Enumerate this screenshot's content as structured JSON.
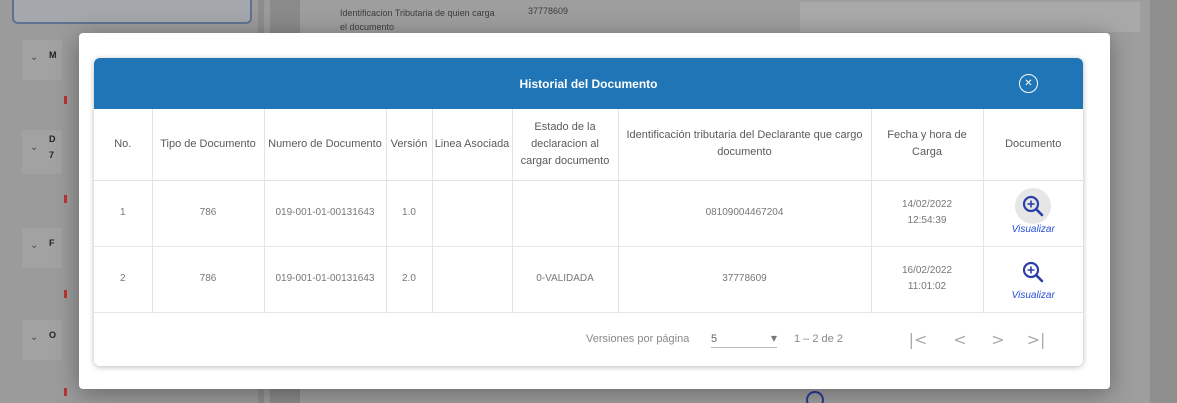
{
  "background": {
    "field_label": "Identificacion Tributaria de quien carga el documento",
    "field_value": "37778609",
    "accordion_letters": [
      "M",
      "D",
      "F",
      "O"
    ],
    "accordion_digit": "7"
  },
  "modal": {
    "title": "Historial del Documento",
    "close_icon": "close-circle-icon",
    "columns": [
      "No.",
      "Tipo de Documento",
      "Numero de Documento",
      "Versión",
      "Linea Asociada",
      "Estado de la declaracion al cargar documento",
      "Identificación tributaria del Declarante que cargo documento",
      "Fecha y hora de Carga",
      "Documento"
    ],
    "rows": [
      {
        "no": "1",
        "tipo": "786",
        "numero": "019-001-01-00131643",
        "version": "1.0",
        "linea": "",
        "estado": "",
        "identificacion": "08109004467204",
        "fecha": "14/02/2022",
        "hora": "12:54:39",
        "accion": "Visualizar"
      },
      {
        "no": "2",
        "tipo": "786",
        "numero": "019-001-01-00131643",
        "version": "2.0",
        "linea": "",
        "estado": "0-VALIDADA",
        "identificacion": "37778609",
        "fecha": "16/02/2022",
        "hora": "11:01:02",
        "accion": "Visualizar"
      }
    ],
    "footer": {
      "per_page_label": "Versiones por página",
      "per_page_value": "5",
      "range": "1 – 2 de 2"
    }
  },
  "colors": {
    "header_blue": "#1f75b5",
    "link_blue": "#2b4fd8",
    "zoom_icon": "#2d3ea8"
  }
}
